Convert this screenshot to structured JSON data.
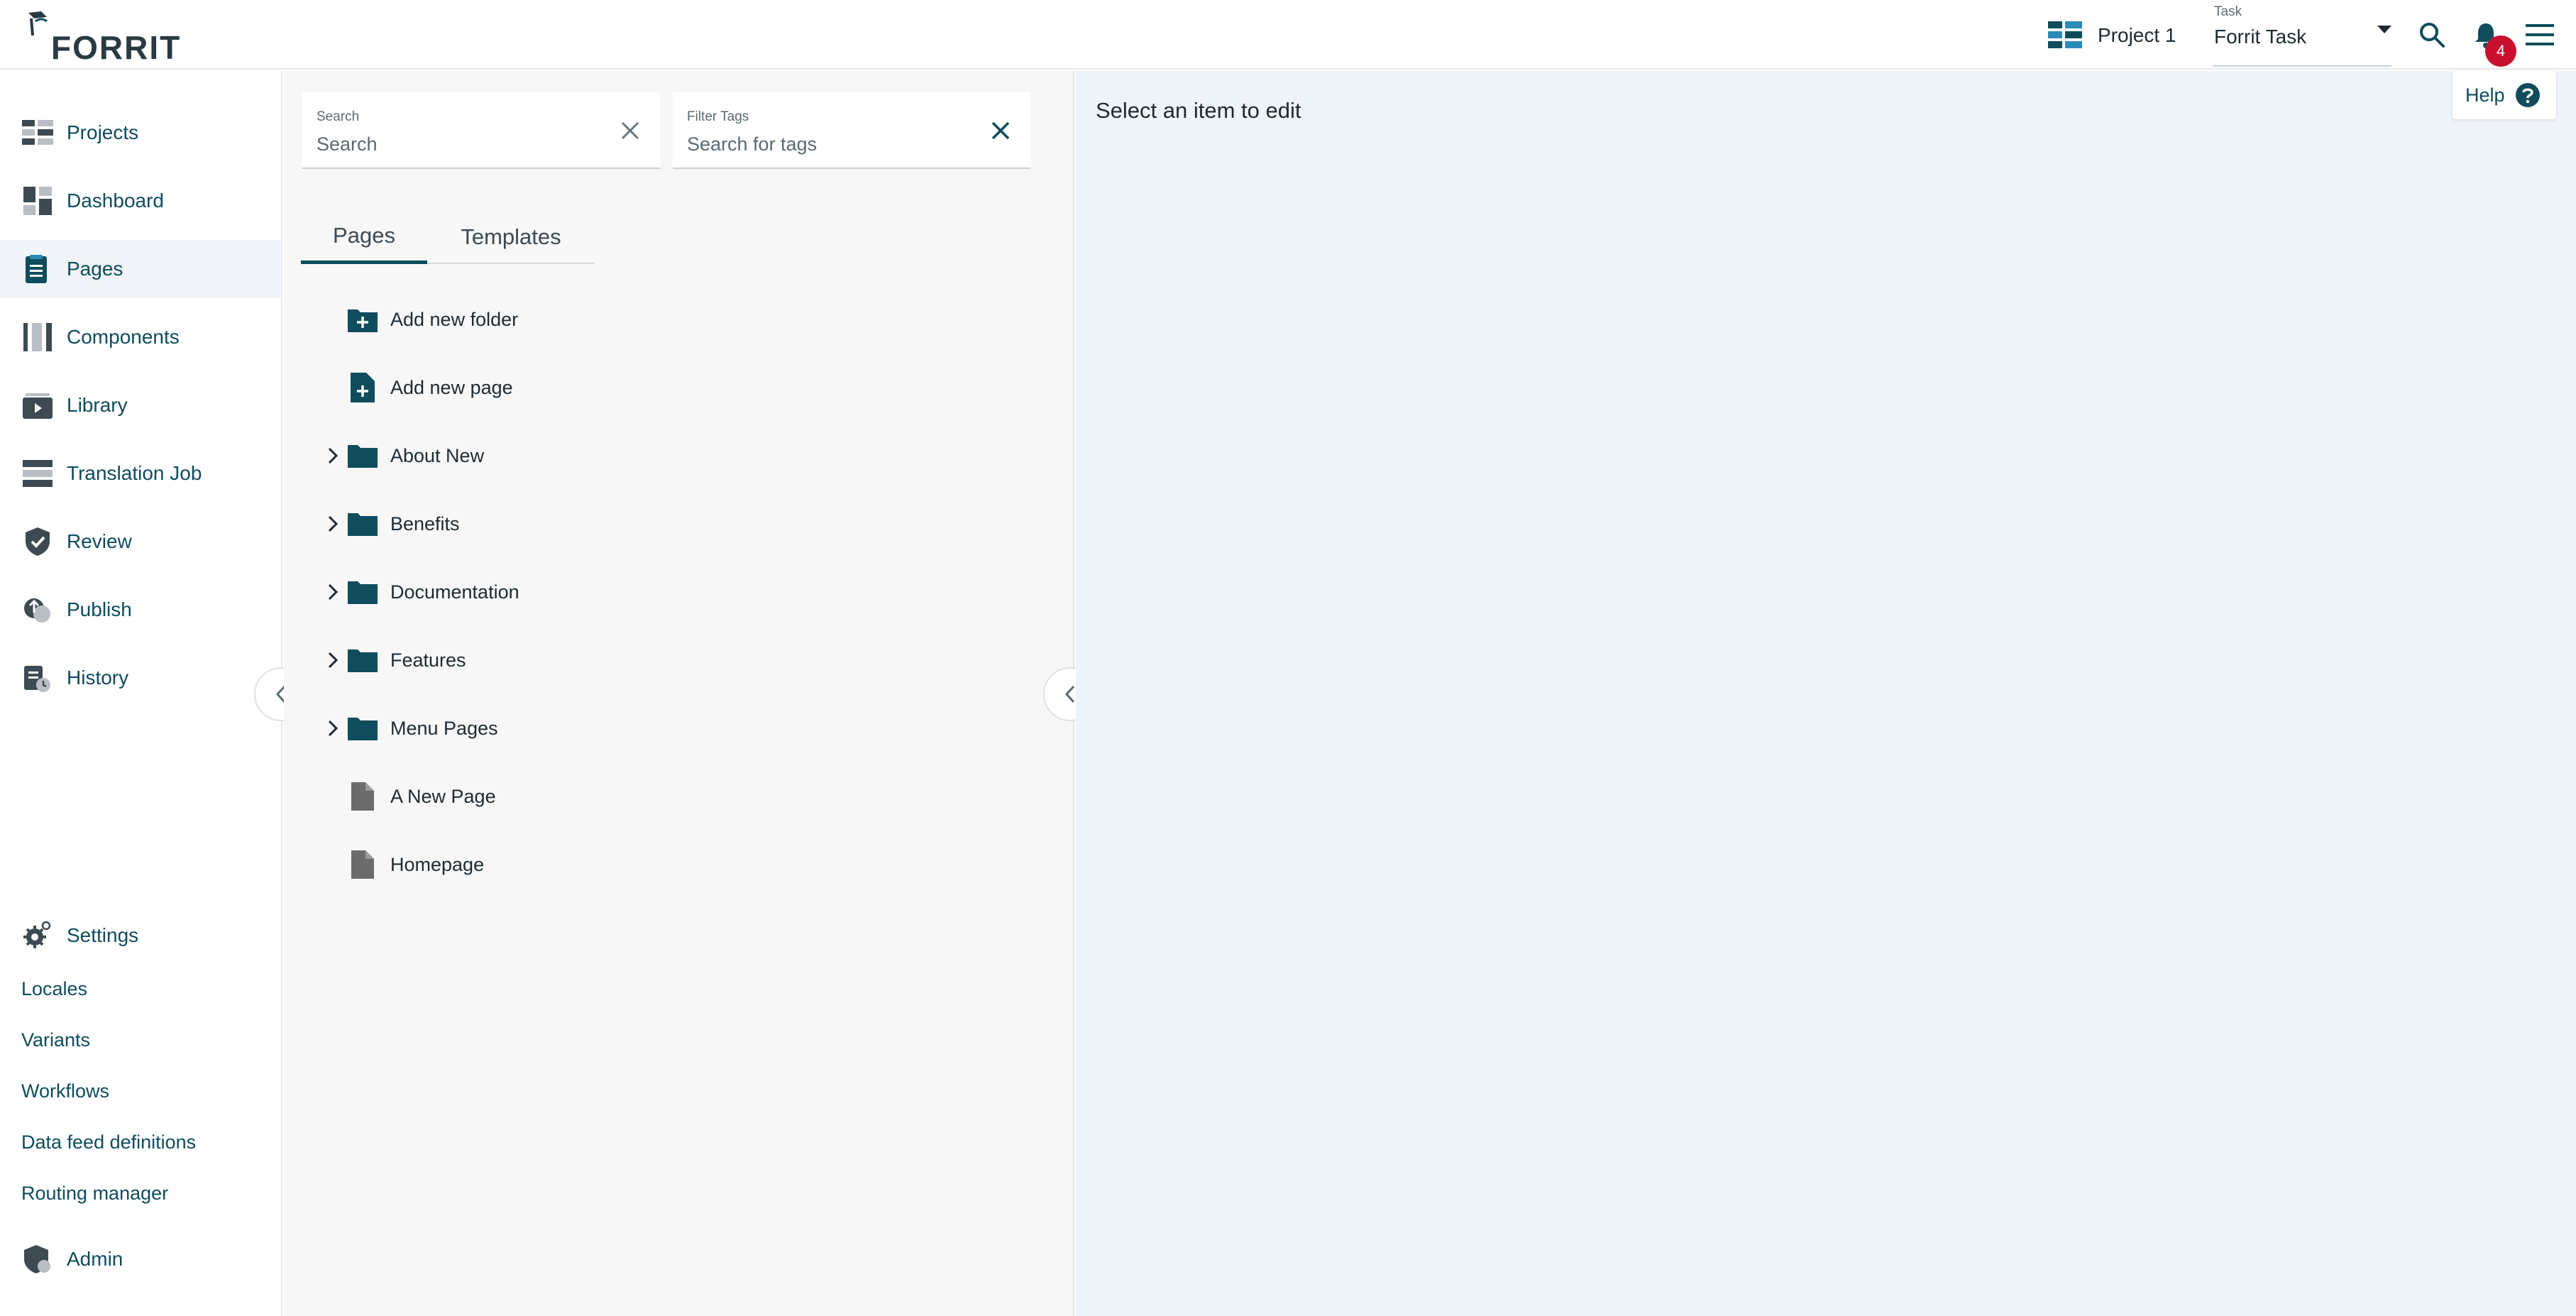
{
  "app": {
    "brand": "FORRIT",
    "accent": "#0f4c5c",
    "badge_color": "#c8102e"
  },
  "header": {
    "project_label": "Project 1",
    "task": {
      "label": "Task",
      "value": "Forrit Task"
    },
    "notification_count": "4",
    "icons": [
      "project-grid-icon",
      "search-icon",
      "bell-icon",
      "menu-icon"
    ]
  },
  "sidebar": {
    "items": [
      {
        "label": "Projects",
        "icon": "projects-icon"
      },
      {
        "label": "Dashboard",
        "icon": "dashboard-icon"
      },
      {
        "label": "Pages",
        "icon": "pages-icon",
        "active": true
      },
      {
        "label": "Components",
        "icon": "components-icon"
      },
      {
        "label": "Library",
        "icon": "library-icon"
      },
      {
        "label": "Translation Job",
        "icon": "translation-icon"
      },
      {
        "label": "Review",
        "icon": "review-icon"
      },
      {
        "label": "Publish",
        "icon": "publish-icon"
      },
      {
        "label": "History",
        "icon": "history-icon"
      }
    ],
    "settings": {
      "label": "Settings",
      "links": [
        "Locales",
        "Variants",
        "Workflows",
        "Data feed definitions",
        "Routing manager"
      ]
    },
    "admin": {
      "label": "Admin"
    }
  },
  "middle": {
    "search": {
      "label": "Search",
      "placeholder": "Search"
    },
    "tags": {
      "label": "Filter Tags",
      "placeholder": "Search for tags"
    },
    "tabs": [
      {
        "label": "Pages",
        "active": true
      },
      {
        "label": "Templates",
        "active": false
      }
    ],
    "tree": [
      {
        "label": "Add new folder",
        "type": "add-folder"
      },
      {
        "label": "Add new page",
        "type": "add-page"
      },
      {
        "label": "About New",
        "type": "folder"
      },
      {
        "label": "Benefits",
        "type": "folder"
      },
      {
        "label": "Documentation",
        "type": "folder"
      },
      {
        "label": "Features",
        "type": "folder"
      },
      {
        "label": "Menu Pages",
        "type": "folder"
      },
      {
        "label": "A New Page",
        "type": "page"
      },
      {
        "label": "Homepage",
        "type": "page"
      }
    ]
  },
  "content": {
    "empty_message": "Select an item to edit",
    "help_label": "Help"
  }
}
